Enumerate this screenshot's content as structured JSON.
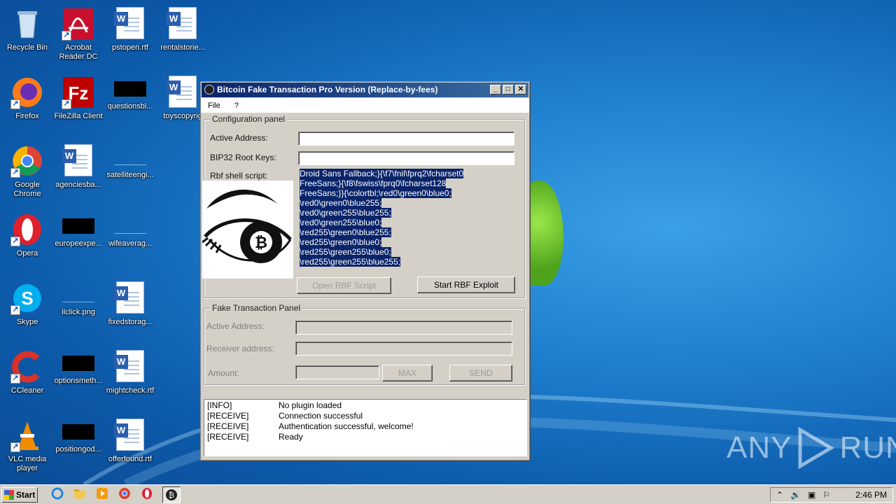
{
  "desktop": {
    "icons": [
      {
        "label": "Recycle Bin"
      },
      {
        "label": "Acrobat Reader DC"
      },
      {
        "label": "pstopen.rtf"
      },
      {
        "label": "rentalstorie..."
      },
      {
        "label": "Firefox"
      },
      {
        "label": "FileZilla Client"
      },
      {
        "label": "questionsbl..."
      },
      {
        "label": "toyscopyrig"
      },
      {
        "label": "Google Chrome"
      },
      {
        "label": "agenciesba..."
      },
      {
        "label": "satelliteengi..."
      },
      {
        "label": "Opera"
      },
      {
        "label": "europeexpe..."
      },
      {
        "label": "wifeaverag..."
      },
      {
        "label": "Skype"
      },
      {
        "label": "ilclick.png"
      },
      {
        "label": "fixedstorag..."
      },
      {
        "label": "CCleaner"
      },
      {
        "label": "optionsmeth..."
      },
      {
        "label": "mightcheck.rtf"
      },
      {
        "label": "VLC media player"
      },
      {
        "label": "positiongod..."
      },
      {
        "label": "offerfound.rtf"
      }
    ]
  },
  "window": {
    "title": "Bitcoin Fake Transaction Pro Version  (Replace-by-fees)",
    "menu": [
      "File",
      "?"
    ],
    "config": {
      "title": "Configuration panel",
      "active_address_label": "Active Address:",
      "active_address_value": "",
      "bip32_label": "BIP32 Root Keys:",
      "bip32_value": "",
      "script_label": "Rbf shell script:",
      "script_lines": [
        "Droid Sans Fallback;}{\\f7\\fnil\\fprq2\\fcharset0",
        "FreeSans;}{\\f8\\fswiss\\fprq0\\fcharset128",
        "FreeSans;}}{\\colortbl;\\red0\\green0\\blue0;",
        "\\red0\\green0\\blue255;",
        "\\red0\\green255\\blue255;",
        "\\red0\\green255\\blue0;",
        "\\red255\\green0\\blue255;",
        "\\red255\\green0\\blue0;",
        "\\red255\\green255\\blue0;",
        "\\red255\\green255\\blue255;"
      ],
      "open_button": "Open RBF Script",
      "start_button": "Start RBF Exploit"
    },
    "fake": {
      "title": "Fake Transaction Panel",
      "active_address_label": "Active Address:",
      "receiver_label": "Receiver address:",
      "amount_label": "Amount:",
      "max_button": "MAX",
      "send_button": "SEND"
    },
    "log": [
      {
        "tag": "[INFO]",
        "msg": "No plugin loaded"
      },
      {
        "tag": "[RECEIVE]",
        "msg": "Connection successful"
      },
      {
        "tag": "[RECEIVE]",
        "msg": "Authentication successful, welcome!"
      },
      {
        "tag": "[RECEIVE]",
        "msg": "Ready"
      }
    ]
  },
  "taskbar": {
    "start_label": "Start",
    "clock": "2:46 PM"
  },
  "watermark": {
    "left": "ANY",
    "right": "RUN"
  }
}
